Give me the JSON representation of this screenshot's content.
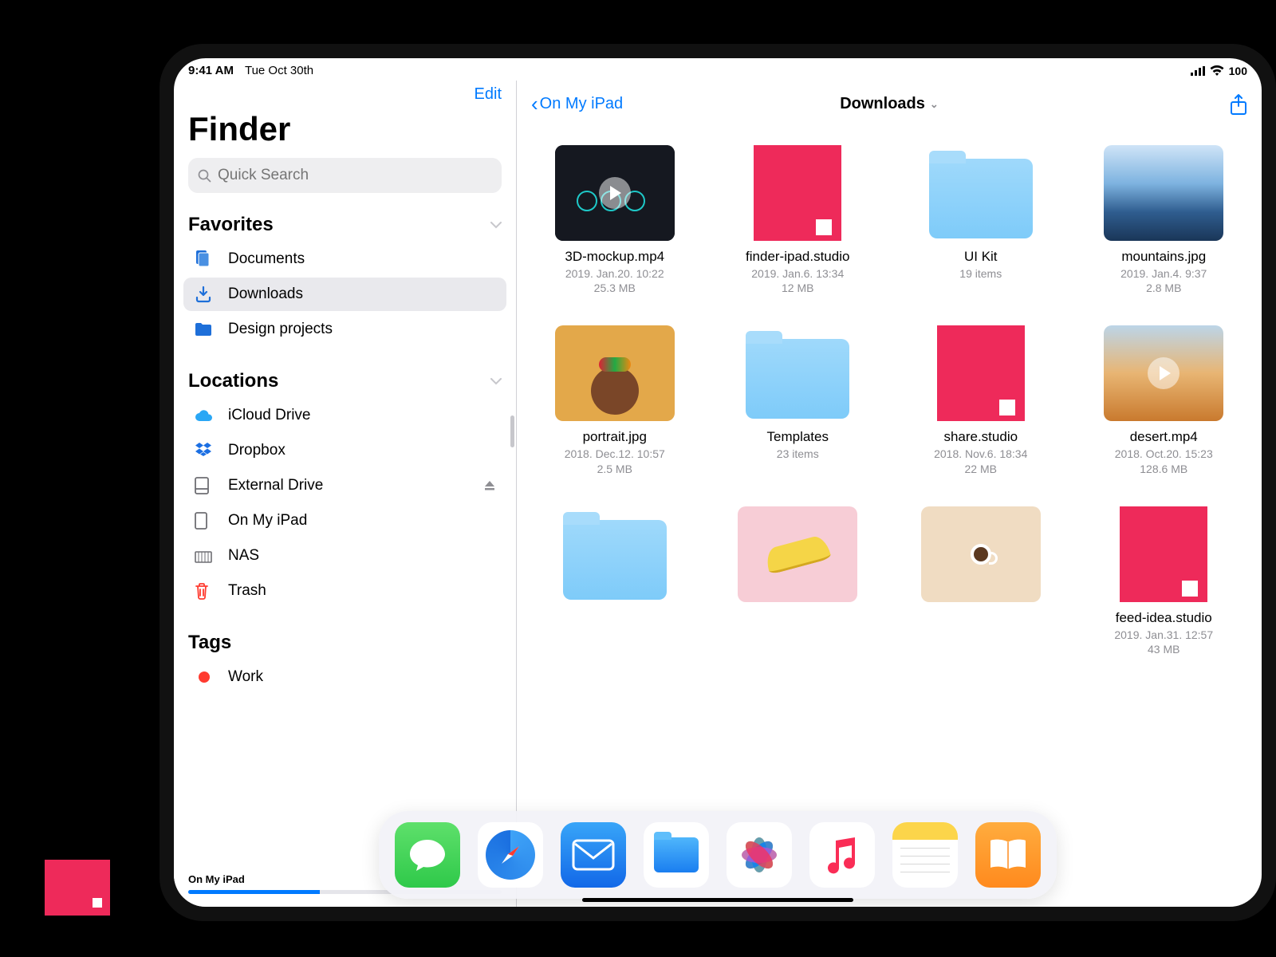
{
  "status": {
    "time": "9:41 AM",
    "date": "Tue Oct 30th",
    "battery": "100"
  },
  "sidebar": {
    "edit": "Edit",
    "title": "Finder",
    "searchPlaceholder": "Quick Search",
    "sections": {
      "favorites": "Favorites",
      "locations": "Locations",
      "tags": "Tags"
    },
    "favorites": [
      {
        "label": "Documents"
      },
      {
        "label": "Downloads"
      },
      {
        "label": "Design projects"
      }
    ],
    "locations": [
      {
        "label": "iCloud Drive"
      },
      {
        "label": "Dropbox"
      },
      {
        "label": "External Drive"
      },
      {
        "label": "On My iPad"
      },
      {
        "label": "NAS"
      },
      {
        "label": "Trash"
      }
    ],
    "tags": [
      {
        "label": "Work",
        "color": "#ff3b30"
      }
    ],
    "storage": {
      "label": "On My iPad",
      "percent": 42
    }
  },
  "header": {
    "back": "On My iPad",
    "title": "Downloads"
  },
  "files": [
    {
      "name": "3D-mockup.mp4",
      "meta1": "2019. Jan.20. 10:22",
      "meta2": "25.3 MB",
      "kind": "video-dark"
    },
    {
      "name": "finder-ipad.studio",
      "meta1": "2019. Jan.6. 13:34",
      "meta2": "12 MB",
      "kind": "studio"
    },
    {
      "name": "UI Kit",
      "meta1": "19 items",
      "meta2": "",
      "kind": "folder"
    },
    {
      "name": "mountains.jpg",
      "meta1": "2019. Jan.4. 9:37",
      "meta2": "2.8 MB",
      "kind": "mountains"
    },
    {
      "name": "portrait.jpg",
      "meta1": "2018. Dec.12. 10:57",
      "meta2": "2.5 MB",
      "kind": "portrait"
    },
    {
      "name": "Templates",
      "meta1": "23 items",
      "meta2": "",
      "kind": "folder"
    },
    {
      "name": "share.studio",
      "meta1": "2018. Nov.6. 18:34",
      "meta2": "22 MB",
      "kind": "studio"
    },
    {
      "name": "desert.mp4",
      "meta1": "2018. Oct.20. 15:23",
      "meta2": "128.6 MB",
      "kind": "desert-video"
    },
    {
      "name": "",
      "meta1": "",
      "meta2": "",
      "kind": "folder"
    },
    {
      "name": "",
      "meta1": "",
      "meta2": "",
      "kind": "banana"
    },
    {
      "name": "",
      "meta1": "",
      "meta2": "",
      "kind": "coffee"
    },
    {
      "name": "feed-idea.studio",
      "meta1": "2019. Jan.31. 12:57",
      "meta2": "43 MB",
      "kind": "studio"
    }
  ],
  "dock": [
    "Messages",
    "Safari",
    "Mail",
    "Files",
    "Photos",
    "Music",
    "Notes",
    "Books"
  ]
}
